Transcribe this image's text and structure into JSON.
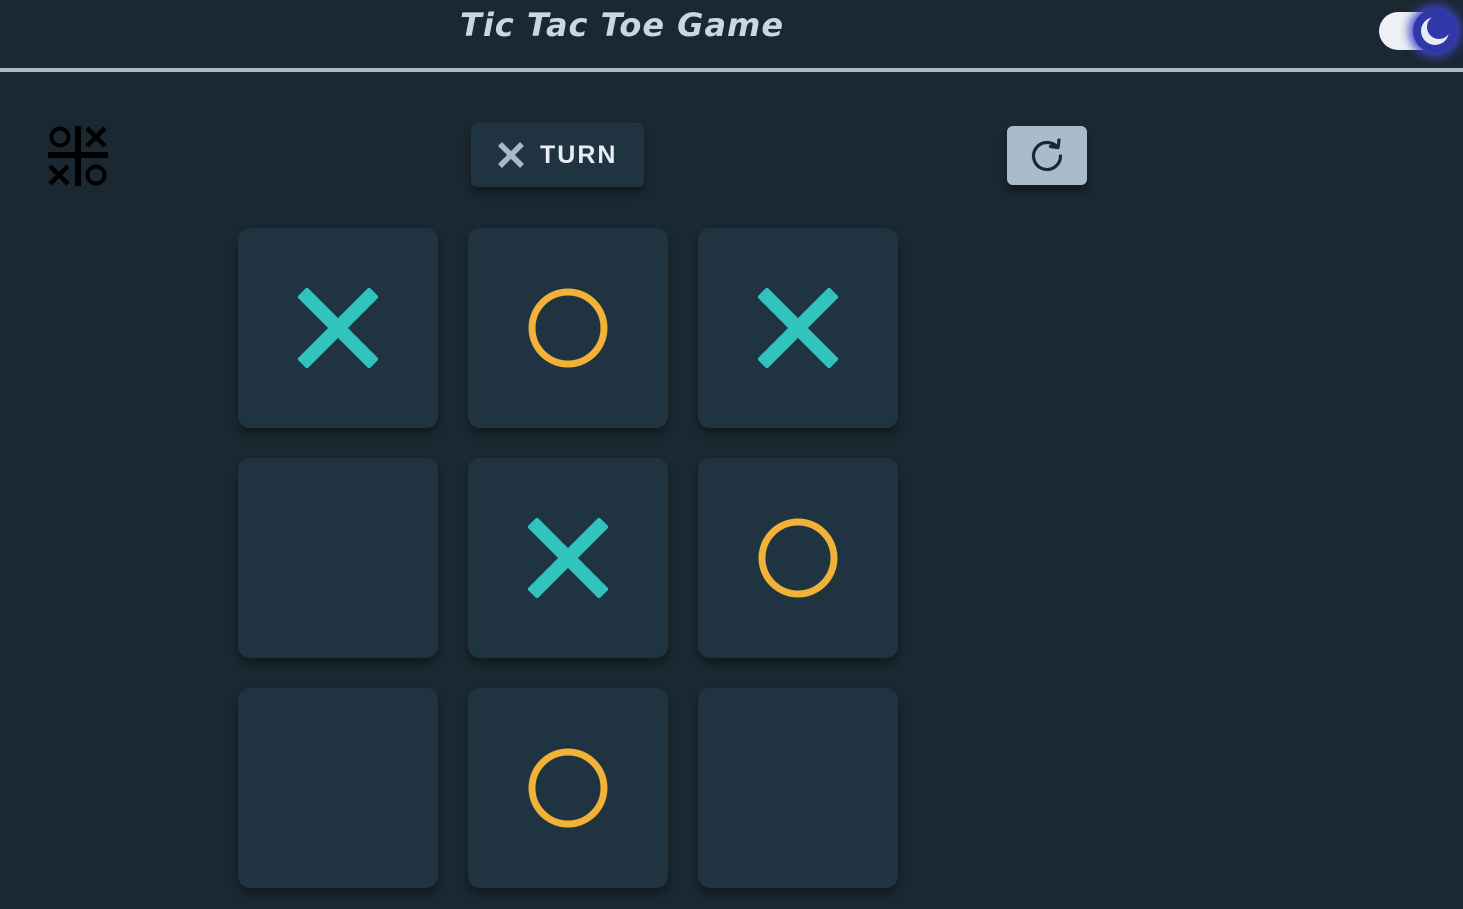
{
  "header": {
    "title": "Tic Tac Toe Game"
  },
  "theme_toggle": {
    "icon": "moon-icon",
    "state": "dark"
  },
  "logo": {
    "icon": "tic-tac-toe-logo-icon"
  },
  "turn": {
    "player": "X",
    "label": "TURN"
  },
  "restart": {
    "icon": "restart-icon"
  },
  "board": {
    "cells": [
      "X",
      "O",
      "X",
      "",
      "X",
      "O",
      "",
      "O",
      ""
    ]
  },
  "colors": {
    "background": "#1a2831",
    "cell": "#1f3440",
    "x_mark": "#31c4be",
    "o_mark": "#f2b137",
    "title": "#c9d6e3",
    "header_line": "#a9b9c9",
    "restart_button": "#a9bcc9",
    "turn_text": "#e8edf2",
    "turn_x": "#a9b9c9"
  }
}
